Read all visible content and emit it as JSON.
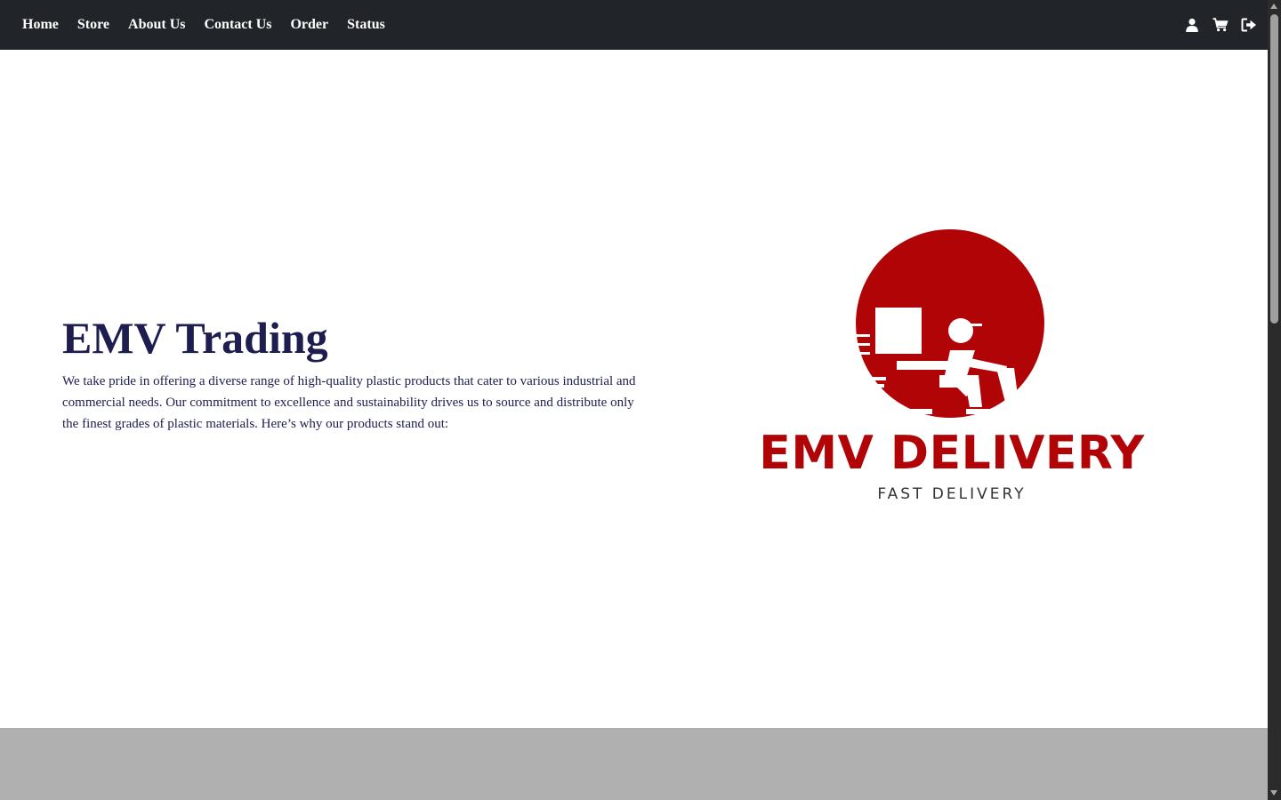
{
  "nav": {
    "links": [
      "Home",
      "Store",
      "About Us",
      "Contact Us",
      "Order",
      "Status"
    ],
    "icons": [
      "user-icon",
      "cart-icon",
      "logout-icon"
    ]
  },
  "hero": {
    "title": "EMV Trading",
    "description": "We take pride in offering a diverse range of high-quality plastic products that cater to various industrial and commercial needs. Our commitment to excellence and sustainability drives us to source and distribute only the finest grades of plastic materials. Here’s why our products stand out:"
  },
  "logo": {
    "name": "EMV DELIVERY",
    "tagline": "FAST DELIVERY",
    "brand_color": "#b10406"
  },
  "colors": {
    "navbar": "#212529",
    "heading": "#1d1d4f",
    "footer_band": "#b0b0b0"
  }
}
